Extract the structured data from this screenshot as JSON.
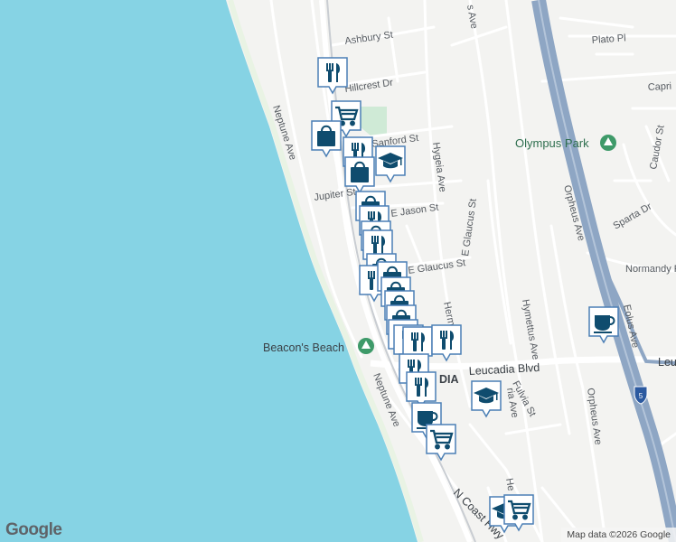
{
  "map": {
    "streets": {
      "ashbury": "Ashbury St",
      "hillcrest": "Hillcrest Dr",
      "neptune_north": "Neptune Ave",
      "neptune_south": "Neptune Ave",
      "sanford": "Sanford St",
      "hygeia": "Hygeia Ave",
      "jupiter": "Jupiter St",
      "jason": "E Jason St",
      "glaucus_east": "E Glaucus St",
      "glaucus_vertical": "E Glaucus St",
      "hermes": "Hermes Ave",
      "hymettus": "Hymettus Ave",
      "leucadia_blvd": "Leucadia Blvd",
      "leucadia_blvd_east": "Leu",
      "fulvia": "Fulvia St",
      "orpheus_north": "Orpheus Ave",
      "orpheus_south": "Orpheus Ave",
      "eolus": "Eolus Ave",
      "plato": "Plato Pl",
      "capri": "Capri",
      "caudor": "Caudor St",
      "sparta": "Sparta Dr",
      "normandy": "Normandy R",
      "coast_hwy": "N Coast Hwy",
      "top_ave": "s Ave",
      "ria": "ria Ave",
      "he": "He",
      "dia": "DIA",
      "freeway_shield": "5"
    },
    "places": {
      "beacons_beach": "Beacon's Beach",
      "olympus_park": "Olympus Park"
    },
    "branding": {
      "logo": "Google",
      "attribution": "Map data ©2026 Google"
    },
    "colors": {
      "ocean": "#86d3e4",
      "land": "#f3f3f1",
      "road": "#ffffff",
      "freeway": "#8ea6c4",
      "park": "#cfead6",
      "marker_bg": "#ffffff",
      "marker_icon": "#0f4c6e",
      "marker_border": "#4b7fb5"
    },
    "markers": [
      {
        "type": "restaurant",
        "icon": "fork-knife-icon"
      },
      {
        "type": "grocery",
        "icon": "shopping-cart-icon"
      },
      {
        "type": "shopping",
        "icon": "shopping-bag-icon"
      },
      {
        "type": "restaurant",
        "icon": "fork-knife-icon"
      },
      {
        "type": "shopping",
        "icon": "shopping-bag-icon"
      },
      {
        "type": "school",
        "icon": "graduation-cap-icon"
      },
      {
        "type": "shopping",
        "icon": "shopping-bag-icon"
      },
      {
        "type": "restaurant",
        "icon": "fork-knife-icon"
      },
      {
        "type": "shopping",
        "icon": "shopping-bag-icon"
      },
      {
        "type": "restaurant",
        "icon": "fork-knife-icon"
      },
      {
        "type": "shopping",
        "icon": "shopping-bag-icon"
      },
      {
        "type": "restaurant",
        "icon": "fork-knife-icon"
      },
      {
        "type": "shopping",
        "icon": "shopping-bag-icon"
      },
      {
        "type": "shopping",
        "icon": "shopping-bag-icon"
      },
      {
        "type": "restaurant",
        "icon": "fork-knife-icon"
      },
      {
        "type": "restaurant",
        "icon": "fork-knife-icon"
      },
      {
        "type": "restaurant",
        "icon": "fork-knife-icon"
      },
      {
        "type": "restaurant",
        "icon": "fork-knife-icon"
      },
      {
        "type": "cafe",
        "icon": "coffee-cup-icon"
      },
      {
        "type": "school",
        "icon": "graduation-cap-icon"
      },
      {
        "type": "cafe",
        "icon": "coffee-cup-icon"
      },
      {
        "type": "grocery",
        "icon": "shopping-cart-icon"
      },
      {
        "type": "cafe",
        "icon": "coffee-cup-icon"
      },
      {
        "type": "school",
        "icon": "graduation-cap-icon"
      },
      {
        "type": "grocery",
        "icon": "shopping-cart-icon"
      }
    ]
  }
}
